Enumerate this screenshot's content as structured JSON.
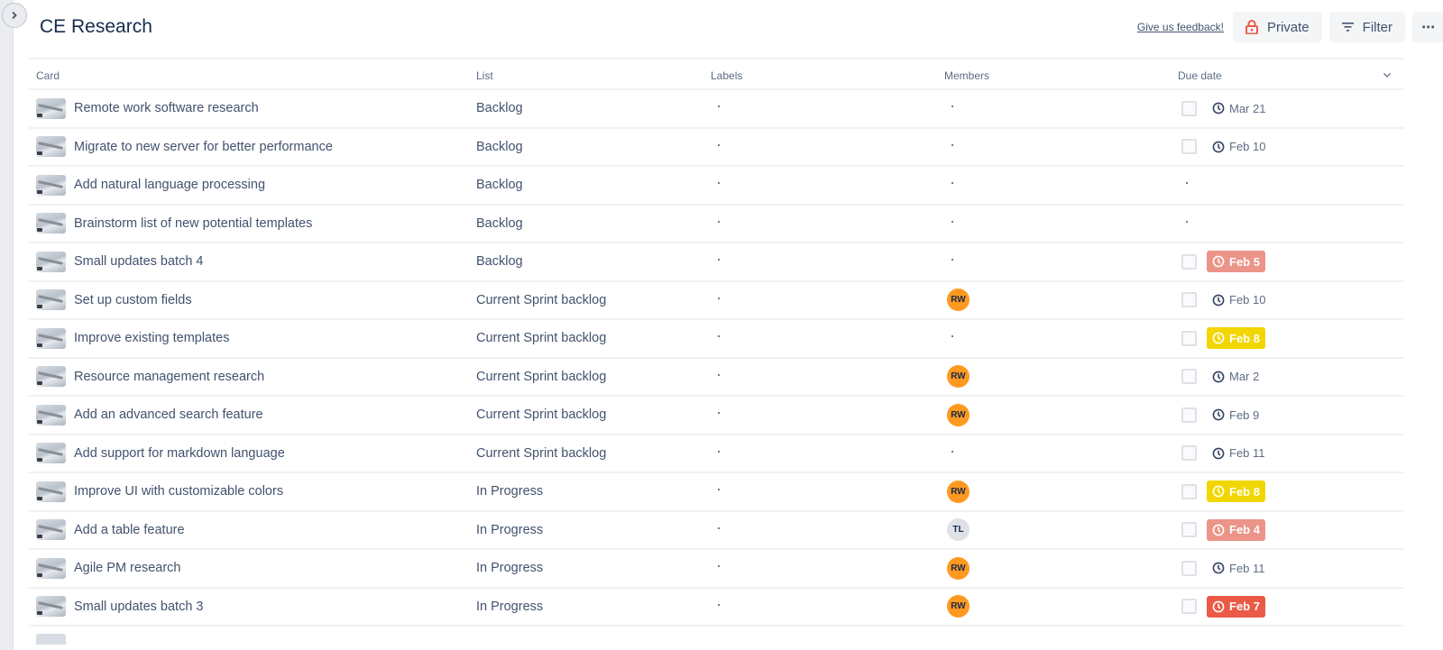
{
  "header": {
    "title": "CE Research",
    "feedback_label": "Give us feedback!",
    "private_label": "Private",
    "filter_label": "Filter",
    "more_label": "⋯"
  },
  "colors": {
    "overdue_light": "#ec9488",
    "due_soon": "#f2d600",
    "overdue": "#eb5a46",
    "avatar_rw": "#ff991f",
    "avatar_tl": "#dfe1e6",
    "lock_icon": "#eb5a46"
  },
  "table": {
    "columns": [
      "Card",
      "List",
      "Labels",
      "Members",
      "Due date"
    ],
    "rows": [
      {
        "card": "Remote work software research",
        "list": "Backlog",
        "labels": "",
        "member": "",
        "has_checkbox": true,
        "due": "Mar 21",
        "due_status": "normal"
      },
      {
        "card": "Migrate to new server for better performance",
        "list": "Backlog",
        "labels": "",
        "member": "",
        "has_checkbox": true,
        "due": "Feb 10",
        "due_status": "normal"
      },
      {
        "card": "Add natural language processing",
        "list": "Backlog",
        "labels": "",
        "member": "",
        "has_checkbox": false,
        "due": "",
        "due_status": "none"
      },
      {
        "card": "Brainstorm list of new potential templates",
        "list": "Backlog",
        "labels": "",
        "member": "",
        "has_checkbox": false,
        "due": "",
        "due_status": "none"
      },
      {
        "card": "Small updates batch 4",
        "list": "Backlog",
        "labels": "",
        "member": "",
        "has_checkbox": true,
        "due": "Feb 5",
        "due_status": "overdue_light"
      },
      {
        "card": "Set up custom fields",
        "list": "Current Sprint backlog",
        "labels": "",
        "member": "RW",
        "has_checkbox": true,
        "due": "Feb 10",
        "due_status": "normal"
      },
      {
        "card": "Improve existing templates",
        "list": "Current Sprint backlog",
        "labels": "",
        "member": "",
        "has_checkbox": true,
        "due": "Feb 8",
        "due_status": "due_soon"
      },
      {
        "card": "Resource management research",
        "list": "Current Sprint backlog",
        "labels": "",
        "member": "RW",
        "has_checkbox": true,
        "due": "Mar 2",
        "due_status": "normal"
      },
      {
        "card": "Add an advanced search feature",
        "list": "Current Sprint backlog",
        "labels": "",
        "member": "RW",
        "has_checkbox": true,
        "due": "Feb 9",
        "due_status": "normal"
      },
      {
        "card": "Add support for markdown language",
        "list": "Current Sprint backlog",
        "labels": "",
        "member": "",
        "has_checkbox": true,
        "due": "Feb 11",
        "due_status": "normal"
      },
      {
        "card": "Improve UI with customizable colors",
        "list": "In Progress",
        "labels": "",
        "member": "RW",
        "has_checkbox": true,
        "due": "Feb 8",
        "due_status": "due_soon"
      },
      {
        "card": "Add a table feature",
        "list": "In Progress",
        "labels": "",
        "member": "TL",
        "has_checkbox": true,
        "due": "Feb 4",
        "due_status": "overdue_light"
      },
      {
        "card": "Agile PM research",
        "list": "In Progress",
        "labels": "",
        "member": "RW",
        "has_checkbox": true,
        "due": "Feb 11",
        "due_status": "normal"
      },
      {
        "card": "Small updates batch 3",
        "list": "In Progress",
        "labels": "",
        "member": "RW",
        "has_checkbox": true,
        "due": "Feb 7",
        "due_status": "overdue"
      }
    ]
  }
}
